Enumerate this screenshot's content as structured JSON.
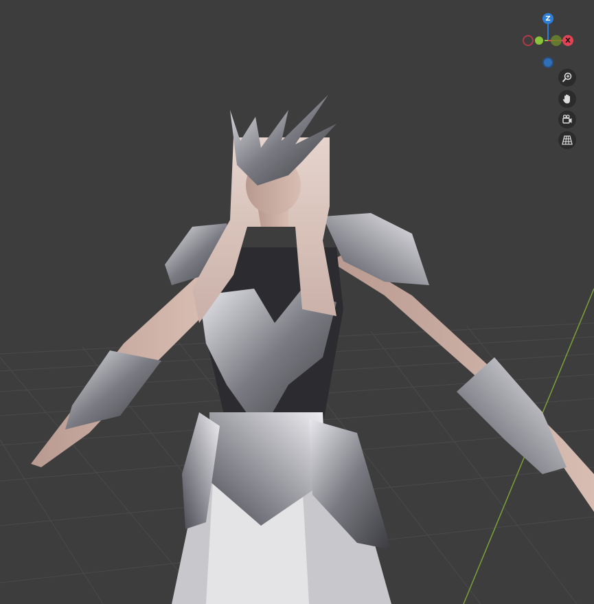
{
  "viewport": {
    "background_color": "#3d3d3d",
    "grid_color": "#4a4a4a",
    "y_axis_color": "#7aa33a"
  },
  "gizmo": {
    "z_label": "Z",
    "x_label": "X",
    "y_label": "",
    "colors": {
      "x": "#e04455",
      "y": "#8ac33a",
      "z": "#2f7fd8"
    }
  },
  "tools": [
    {
      "name": "zoom",
      "icon": "zoom-icon"
    },
    {
      "name": "pan",
      "icon": "hand-icon"
    },
    {
      "name": "camera",
      "icon": "camera-icon"
    },
    {
      "name": "perspective",
      "icon": "grid-icon"
    }
  ]
}
